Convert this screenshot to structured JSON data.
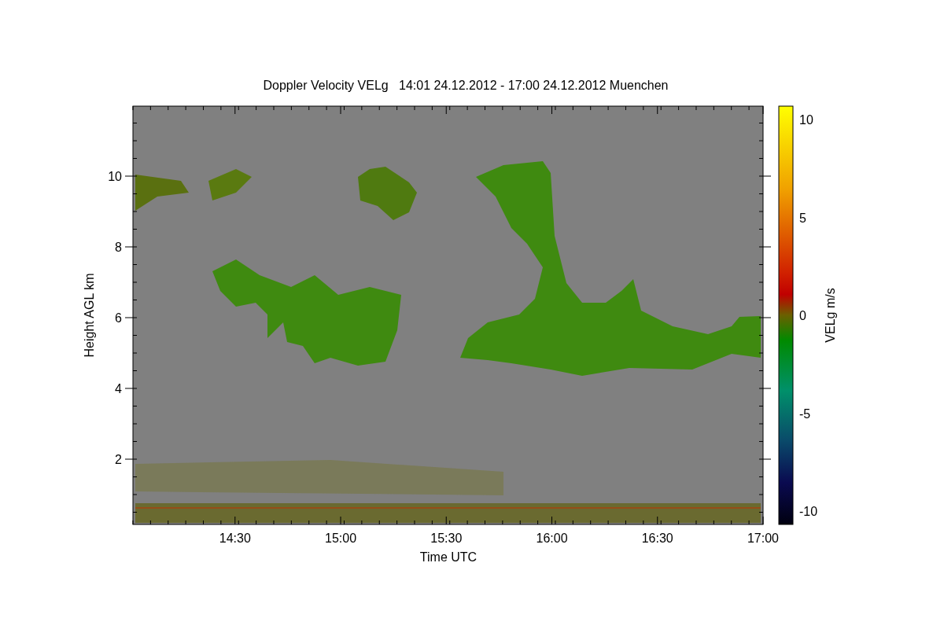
{
  "chart": {
    "title": "Doppler Velocity VELg   14:01 24.12.2012 - 17:00 24.12.2012 Muenchen",
    "xlabel": "Time UTC",
    "ylabel": "Height AGL km",
    "xticks": [
      "14:30",
      "15:00",
      "15:30",
      "16:00",
      "16:30",
      "17:00"
    ],
    "yticks": [
      "10",
      "8",
      "6",
      "4",
      "2"
    ]
  },
  "colorbar": {
    "label": "VELg m/s",
    "ticks": [
      "10",
      "5",
      "0",
      "-5",
      "-10"
    ]
  }
}
